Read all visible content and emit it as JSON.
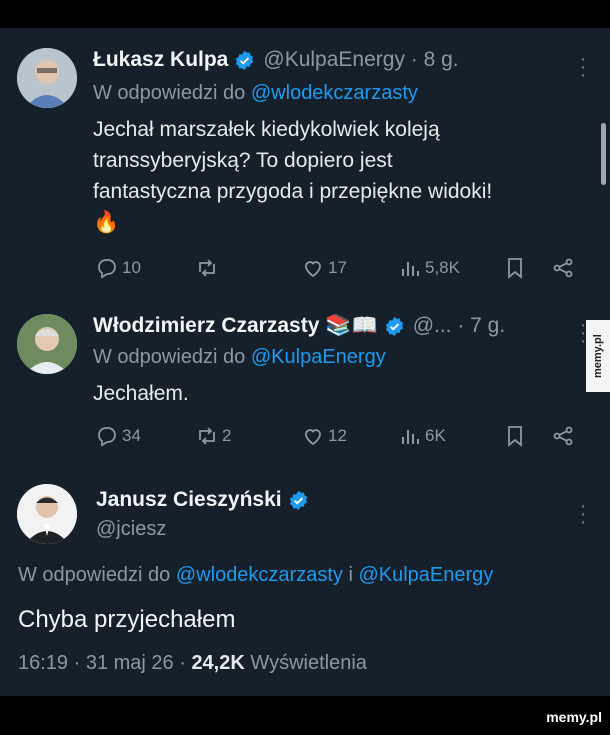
{
  "tweets": [
    {
      "name": "Łukasz Kulpa",
      "handle": "@KulpaEnergy · 8 g.",
      "reply_label": "W odpowiedzi do ",
      "reply_mention": "@wlodekczarzasty",
      "text_lines": [
        "Jechał marszałek kiedykolwiek koleją",
        "transsyberyjską? To dopiero jest",
        "fantastyczna przygoda i przepiękne widoki!"
      ],
      "emoji": "🔥",
      "replies": "10",
      "reposts": "",
      "likes": "17",
      "views": "5,8K"
    },
    {
      "name": "Włodzimierz Czarzasty",
      "name_emoji": "📚📖",
      "handle": "@... · 7 g.",
      "reply_label": "W odpowiedzi do ",
      "reply_mention": "@KulpaEnergy",
      "text": "Jechałem.",
      "replies": "34",
      "reposts": "2",
      "likes": "12",
      "views": "6K"
    }
  ],
  "main_tweet": {
    "name": "Janusz Cieszyński",
    "handle": "@jciesz",
    "reply_label": "W odpowiedzi do ",
    "reply_mention_1": "@wlodekczarzasty",
    "reply_join": " i ",
    "reply_mention_2": "@KulpaEnergy",
    "text": "Chyba przyjechałem",
    "time": "16:19 · 31 maj 26 · ",
    "views_count": "24,2K",
    "views_label": " Wyświetlenia"
  },
  "watermarks": {
    "side": "memy.pl",
    "footer": "memy.pl"
  },
  "icons": [
    "verified-icon",
    "reply-icon",
    "repost-icon",
    "like-icon",
    "views-icon",
    "bookmark-icon",
    "share-icon",
    "more-icon"
  ],
  "colors": {
    "background": "#15202b",
    "accent": "#1d9bf0",
    "muted": "#8899a6"
  }
}
